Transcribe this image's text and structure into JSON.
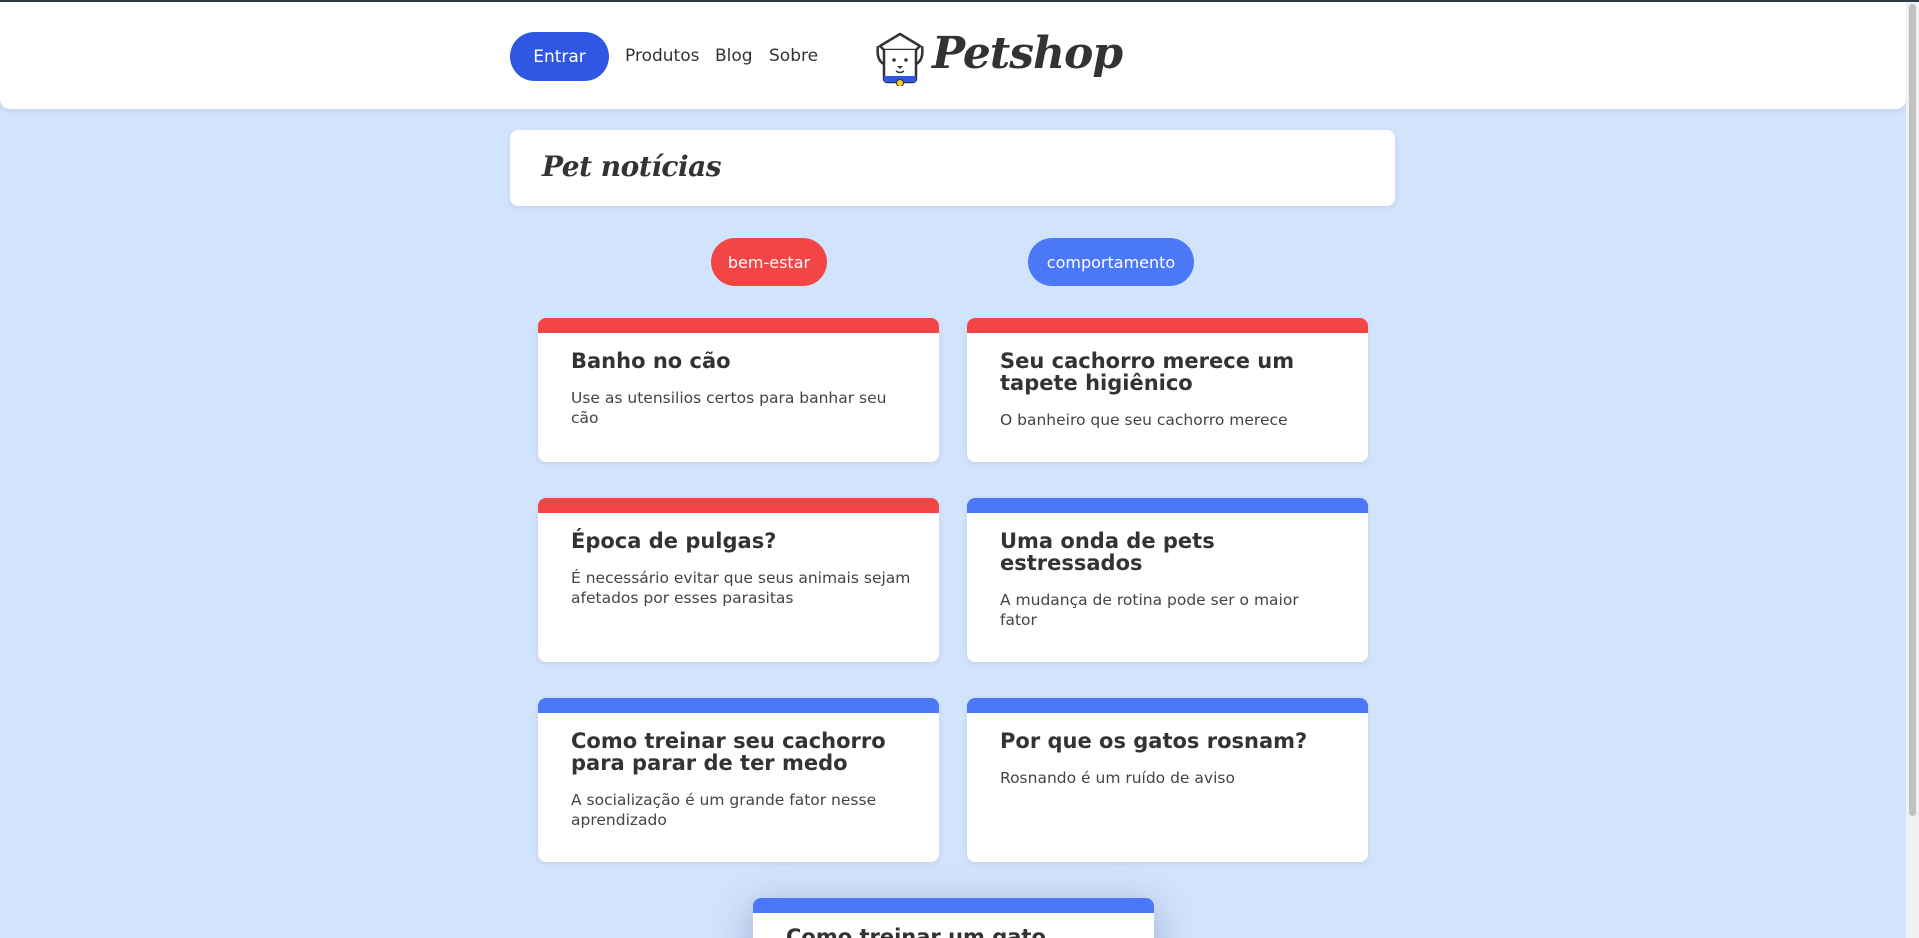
{
  "header": {
    "login_label": "Entrar",
    "nav": [
      "Produtos",
      "Blog",
      "Sobre"
    ],
    "logo_text": "Petshop"
  },
  "page": {
    "title": "Pet notícias"
  },
  "tags": [
    "bem-estar",
    "comportamento"
  ],
  "cards": [
    {
      "title": "Banho no cão",
      "desc": "Use as utensilios certos para banhar seu cão",
      "color": "#f24646"
    },
    {
      "title": "Seu cachorro merece um tapete higiênico",
      "desc": "O banheiro que seu cachorro merece",
      "color": "#f24646"
    },
    {
      "title": "Época de pulgas?",
      "desc": "É necessário evitar que seus animais sejam afetados por esses parasitas",
      "color": "#f24646"
    },
    {
      "title": "Uma onda de pets estressados",
      "desc": "A mudança de rotina pode ser o maior fator",
      "color": "#4a78f6"
    },
    {
      "title": "Como treinar seu cachorro para parar de ter medo",
      "desc": "A socialização é um grande fator nesse aprendizado",
      "color": "#4a78f6"
    },
    {
      "title": "Por que os gatos rosnam?",
      "desc": "Rosnando é um ruído de aviso",
      "color": "#4a78f6"
    },
    {
      "title": "Como treinar um gato",
      "color": "#4a78f6"
    }
  ],
  "colors": {
    "background": "#d2e3fc",
    "primary": "#2f57e4",
    "tag_red": "#f24646",
    "tag_blue": "#4a78f6"
  }
}
